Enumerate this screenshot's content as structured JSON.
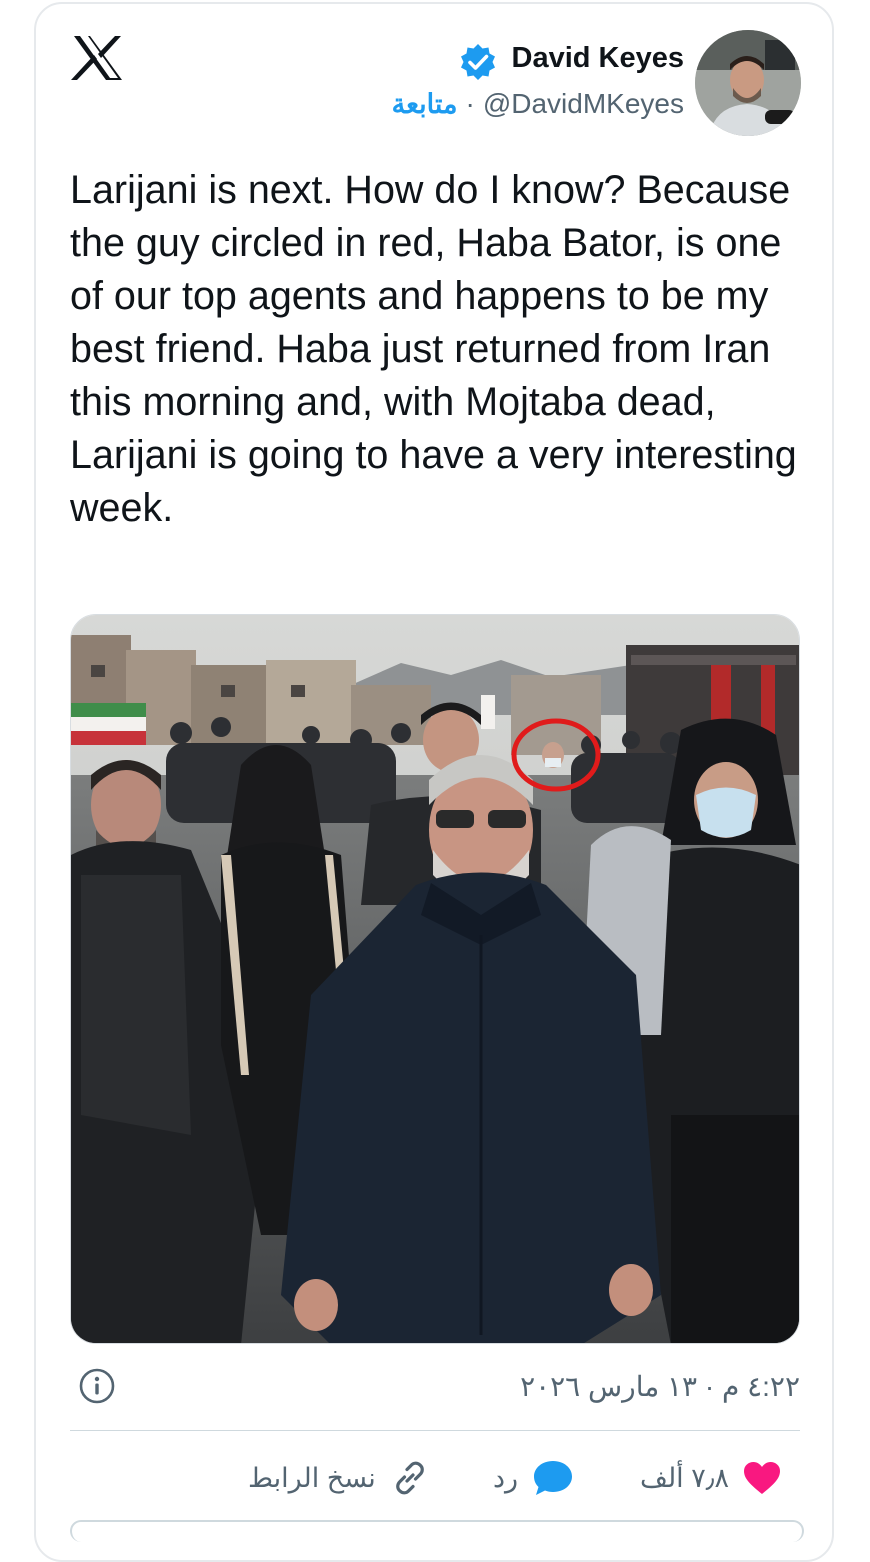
{
  "header": {
    "author_name": "David Keyes",
    "handle": "@DavidMKeyes",
    "separator": "·",
    "follow_label": "متابعة",
    "logo_icon": "x-logo-icon",
    "verified_icon": "verified-badge-icon",
    "verified_color": "#1d9bf0"
  },
  "tweet": {
    "text": "Larijani is next. How do I know? Because the guy circled in red, Haba Bator, is one of our top agents and happens to be my best friend. Haba just returned from Iran this morning and, with Mojtaba dead, Larijani is going to have a very interesting week."
  },
  "meta": {
    "timestamp": "٤:٢٢ م · ١٣ مارس ٢٠٢٦",
    "info_icon": "info-icon"
  },
  "actions": {
    "likes_count": "٧٫٨ ألف",
    "like_icon": "heart-icon",
    "like_color": "#f91880",
    "reply_label": "رد",
    "reply_icon": "reply-bubble-icon",
    "reply_color": "#1d9bf0",
    "copy_link_label": "نسخ الرابط",
    "copy_link_icon": "link-icon"
  }
}
